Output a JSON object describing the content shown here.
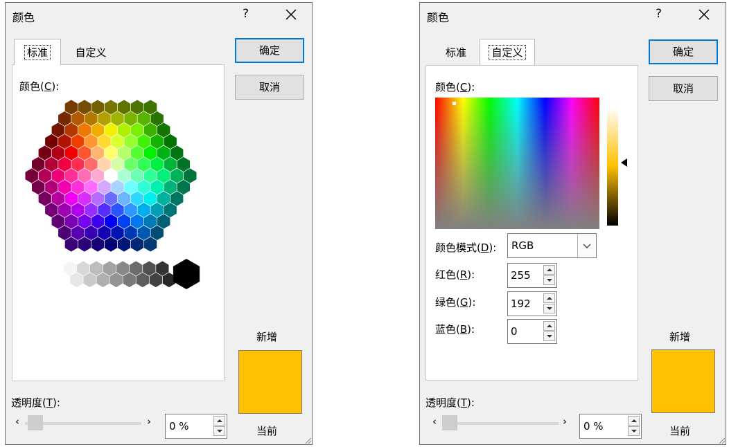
{
  "colors": {
    "new_color": "#ffc000",
    "current_color": "#ffc000",
    "accent": "#0078d7"
  },
  "left_dialog": {
    "title": "颜色",
    "help": "?",
    "tabs": [
      {
        "label": "标准",
        "active": true
      },
      {
        "label": "自定义",
        "active": false
      }
    ],
    "colors_label": "颜色(",
    "colors_label_key": "C",
    "colors_label_end": "):",
    "ok": "确定",
    "cancel": "取消",
    "new_label": "新增",
    "current_label": "当前",
    "transparency_label": "透明度(",
    "transparency_key": "T",
    "transparency_end": "):",
    "transparency_value": "0 %",
    "slider_left": "‹",
    "slider_right": "›"
  },
  "right_dialog": {
    "title": "颜色",
    "help": "?",
    "tabs": [
      {
        "label": "标准",
        "active": false
      },
      {
        "label": "自定义",
        "active": true
      }
    ],
    "colors_label": "颜色(",
    "colors_label_key": "C",
    "colors_label_end": "):",
    "model_label": "颜色模式(",
    "model_key": "D",
    "model_end": "):",
    "model_value": "RGB",
    "red_label": "红色(",
    "red_key": "R",
    "red_end": "):",
    "red_value": "255",
    "green_label": "绿色(",
    "green_key": "G",
    "green_end": "):",
    "green_value": "192",
    "blue_label": "蓝色(",
    "blue_key": "B",
    "blue_end": "):",
    "blue_value": "0",
    "ok": "确定",
    "cancel": "取消",
    "new_label": "新增",
    "current_label": "当前",
    "transparency_label": "透明度(",
    "transparency_key": "T",
    "transparency_end": "):",
    "transparency_value": "0 %",
    "slider_left": "‹",
    "slider_right": "›"
  }
}
